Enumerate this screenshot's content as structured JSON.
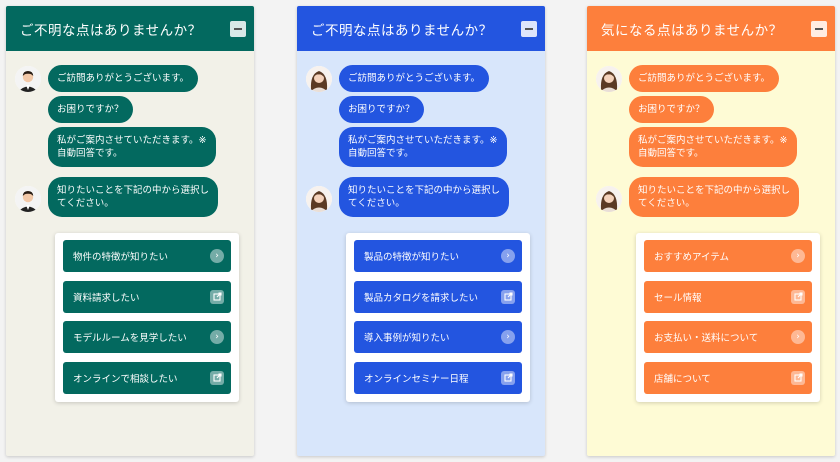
{
  "panels": [
    {
      "colors": {
        "header": "#03695f",
        "bubble": "#03695f",
        "choice": "#03695f",
        "bg": "#f2f1e8"
      },
      "avatar": "male-operator-avatar",
      "header_title": "ご不明な点はありませんか？",
      "messages": [
        "ご訪問ありがとうございます。",
        "お困りですか？",
        "私がご案内させていただきます。※",
        "自動回答です。",
        "知りたいことを下記の中から選択し",
        "てください。"
      ],
      "choices": [
        {
          "label": "物件の特徴が知りたい",
          "icon": "arrow-right-icon"
        },
        {
          "label": "資料請求したい",
          "icon": "external-link-icon"
        },
        {
          "label": "モデルルームを見学したい",
          "icon": "arrow-right-icon"
        },
        {
          "label": "オンラインで相談したい",
          "icon": "external-link-icon"
        }
      ]
    },
    {
      "colors": {
        "header": "#2355e0",
        "bubble": "#2355e0",
        "choice": "#2355e0",
        "bg": "#d8e6fb"
      },
      "avatar": "female-operator-avatar",
      "header_title": "ご不明な点はありませんか？",
      "messages": [
        "ご訪問ありがとうございます。",
        "お困りですか？",
        "私がご案内させていただきます。※",
        "自動回答です。",
        "知りたいことを下記の中から選択し",
        "てください。"
      ],
      "choices": [
        {
          "label": "製品の特徴が知りたい",
          "icon": "arrow-right-icon"
        },
        {
          "label": "製品カタログを請求したい",
          "icon": "external-link-icon"
        },
        {
          "label": "導入事例が知りたい",
          "icon": "arrow-right-icon"
        },
        {
          "label": "オンラインセミナー日程",
          "icon": "external-link-icon"
        }
      ]
    },
    {
      "colors": {
        "header": "#fd7f3c",
        "bubble": "#fd7f3c",
        "choice": "#fd7f3c",
        "bg": "#fefbd5"
      },
      "avatar": "female-operator-avatar",
      "header_title": "気になる点はありませんか？",
      "messages": [
        "ご訪問ありがとうございます。",
        "お困りですか？",
        "私がご案内させていただきます。※",
        "自動回答です。",
        "知りたいことを下記の中から選択し",
        "てください。"
      ],
      "choices": [
        {
          "label": "おすすめアイテム",
          "icon": "arrow-right-icon"
        },
        {
          "label": "セール情報",
          "icon": "external-link-icon"
        },
        {
          "label": "お支払い・送料について",
          "icon": "arrow-right-icon"
        },
        {
          "label": "店舗について",
          "icon": "external-link-icon"
        }
      ]
    }
  ]
}
